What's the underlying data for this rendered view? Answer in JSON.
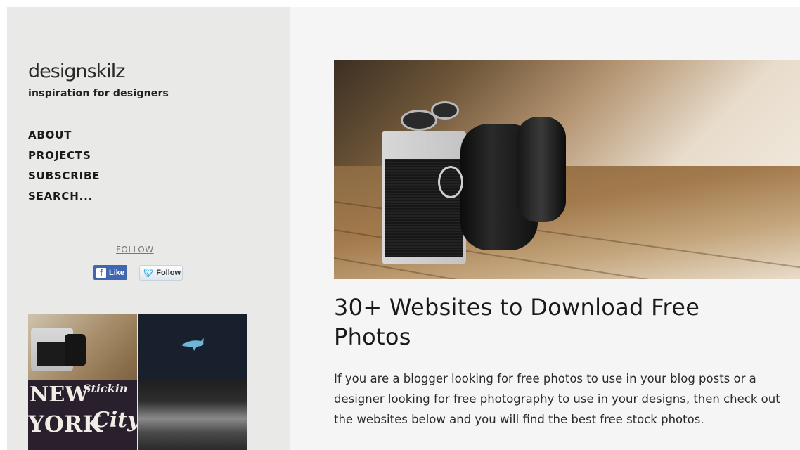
{
  "site": {
    "logo": "designskilz",
    "tagline": "inspiration for designers"
  },
  "nav": {
    "items": [
      {
        "label": "ABOUT"
      },
      {
        "label": "PROJECTS"
      },
      {
        "label": "SUBSCRIBE"
      },
      {
        "label": "SEARCH..."
      }
    ]
  },
  "social": {
    "follow_label": "FOLLOW",
    "facebook_label": "Like",
    "twitter_label": "Follow"
  },
  "thumbnails": {
    "new_york_text": [
      "NEW",
      "YORK",
      "City",
      "Stickin"
    ]
  },
  "post": {
    "title": "30+ Websites to Download Free Photos",
    "excerpt": "If you are a blogger looking for free photos to use in your blog posts or a designer looking for free photography to use in your designs, then check out the websites below and you will find the best free stock photos."
  },
  "colors": {
    "sidebar_bg": "#e9e9e7",
    "content_bg": "#f5f5f5",
    "facebook_blue": "#4267b2",
    "twitter_blue": "#2ea7e0"
  }
}
